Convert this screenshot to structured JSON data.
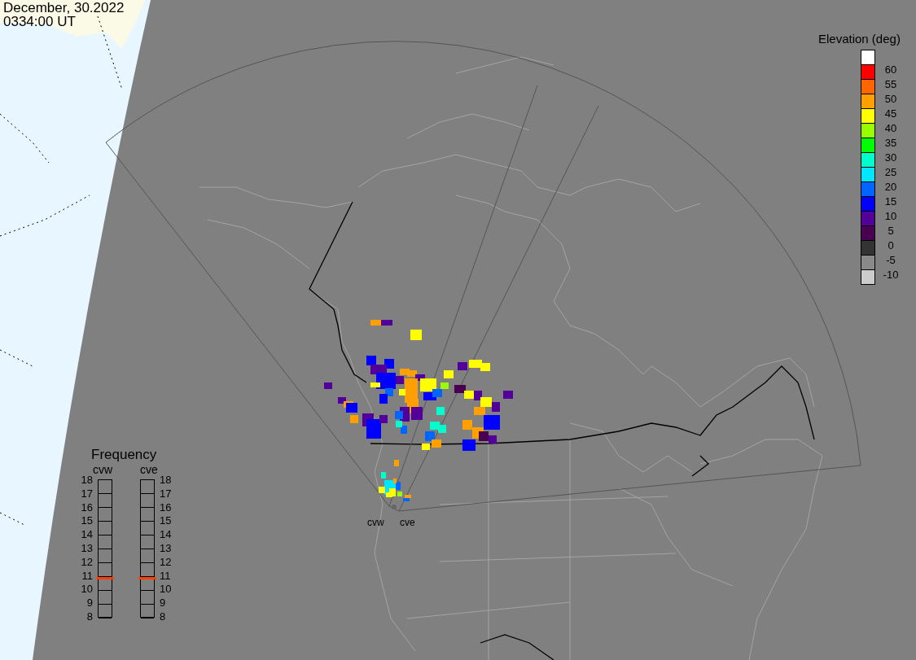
{
  "timestamp": {
    "date": "December, 30.2022",
    "time": "0334:00 UT"
  },
  "elevation_legend": {
    "title": "Elevation (deg)",
    "swatches": [
      {
        "color": "#ffffff"
      },
      {
        "label": "60",
        "color": "#ff0000"
      },
      {
        "label": "55",
        "color": "#ff6600"
      },
      {
        "label": "50",
        "color": "#ffa000"
      },
      {
        "label": "45",
        "color": "#ffff00"
      },
      {
        "label": "40",
        "color": "#99ff00"
      },
      {
        "label": "35",
        "color": "#00ff00"
      },
      {
        "label": "30",
        "color": "#00ffcc"
      },
      {
        "label": "25",
        "color": "#00e6ff"
      },
      {
        "label": "20",
        "color": "#0066ff"
      },
      {
        "label": "15",
        "color": "#0000ff"
      },
      {
        "label": "10",
        "color": "#520099"
      },
      {
        "label": "5",
        "color": "#4a0050"
      },
      {
        "label": "0",
        "color": "#333333"
      },
      {
        "label": "-5",
        "color": "#8a8a8a"
      },
      {
        "label": "-10",
        "color": "#cccccc"
      }
    ]
  },
  "frequency_panel": {
    "title": "Frequency",
    "scales": [
      {
        "name": "cvw",
        "ticks": [
          "18",
          "17",
          "16",
          "15",
          "14",
          "13",
          "12",
          "11",
          "10",
          "9",
          "8"
        ],
        "level": 0.28
      },
      {
        "name": "cve",
        "ticks": [
          "18",
          "17",
          "16",
          "15",
          "14",
          "13",
          "12",
          "11",
          "10",
          "9",
          "8"
        ],
        "level": 0.28
      }
    ]
  },
  "radar_sites": [
    {
      "label": "cvw"
    },
    {
      "label": "cve"
    }
  ]
}
